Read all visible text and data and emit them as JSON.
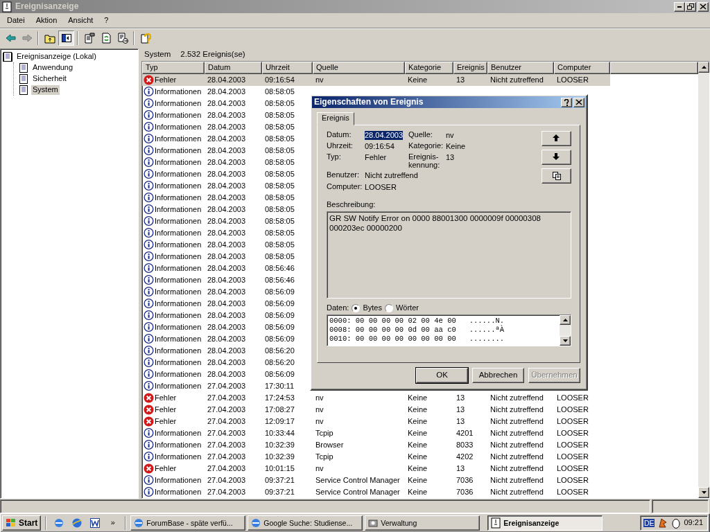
{
  "window": {
    "title": "Ereignisanzeige"
  },
  "menu": [
    "Datei",
    "Aktion",
    "Ansicht",
    "?"
  ],
  "toolbar": [
    {
      "kind": "back",
      "disabled": false,
      "pressed": false
    },
    {
      "kind": "forward",
      "disabled": true,
      "pressed": false
    },
    {
      "kind": "up",
      "disabled": false,
      "pressed": false
    },
    {
      "kind": "tree",
      "disabled": false,
      "pressed": true
    },
    {
      "kind": "properties",
      "disabled": false,
      "pressed": false
    },
    {
      "kind": "refresh",
      "disabled": false,
      "pressed": false
    },
    {
      "kind": "export",
      "disabled": false,
      "pressed": false
    },
    {
      "kind": "help",
      "disabled": false,
      "pressed": false
    }
  ],
  "tree": {
    "label": "Ereignisanzeige (Lokal)",
    "selected": false,
    "children": [
      {
        "label": "Anwendung",
        "selected": false
      },
      {
        "label": "Sicherheit",
        "selected": false
      },
      {
        "label": "System",
        "selected": true
      }
    ]
  },
  "list_header": {
    "title": "System",
    "count": "2.532 Ereignis(se)"
  },
  "table": {
    "columns": [
      "Typ",
      "Datum",
      "Uhrzeit",
      "Quelle",
      "Kategorie",
      "Ereignis",
      "Benutzer",
      "Computer"
    ],
    "rows": [
      {
        "kind": "error",
        "selected": true,
        "cells": [
          "Fehler",
          "28.04.2003",
          "09:16:54",
          "nv",
          "Keine",
          "13",
          "Nicht zutreffend",
          "LOOSER"
        ]
      },
      {
        "kind": "info",
        "selected": false,
        "cells": [
          "Informationen",
          "28.04.2003",
          "08:58:05"
        ]
      },
      {
        "kind": "info",
        "selected": false,
        "cells": [
          "Informationen",
          "28.04.2003",
          "08:58:05"
        ]
      },
      {
        "kind": "info",
        "selected": false,
        "cells": [
          "Informationen",
          "28.04.2003",
          "08:58:05"
        ]
      },
      {
        "kind": "info",
        "selected": false,
        "cells": [
          "Informationen",
          "28.04.2003",
          "08:58:05"
        ]
      },
      {
        "kind": "info",
        "selected": false,
        "cells": [
          "Informationen",
          "28.04.2003",
          "08:58:05"
        ]
      },
      {
        "kind": "info",
        "selected": false,
        "cells": [
          "Informationen",
          "28.04.2003",
          "08:58:05"
        ]
      },
      {
        "kind": "info",
        "selected": false,
        "cells": [
          "Informationen",
          "28.04.2003",
          "08:58:05"
        ]
      },
      {
        "kind": "info",
        "selected": false,
        "cells": [
          "Informationen",
          "28.04.2003",
          "08:58:05"
        ]
      },
      {
        "kind": "info",
        "selected": false,
        "cells": [
          "Informationen",
          "28.04.2003",
          "08:58:05"
        ]
      },
      {
        "kind": "info",
        "selected": false,
        "cells": [
          "Informationen",
          "28.04.2003",
          "08:58:05"
        ]
      },
      {
        "kind": "info",
        "selected": false,
        "cells": [
          "Informationen",
          "28.04.2003",
          "08:58:05"
        ]
      },
      {
        "kind": "info",
        "selected": false,
        "cells": [
          "Informationen",
          "28.04.2003",
          "08:58:05"
        ]
      },
      {
        "kind": "info",
        "selected": false,
        "cells": [
          "Informationen",
          "28.04.2003",
          "08:58:05"
        ]
      },
      {
        "kind": "info",
        "selected": false,
        "cells": [
          "Informationen",
          "28.04.2003",
          "08:58:05"
        ]
      },
      {
        "kind": "info",
        "selected": false,
        "cells": [
          "Informationen",
          "28.04.2003",
          "08:58:05"
        ]
      },
      {
        "kind": "info",
        "selected": false,
        "cells": [
          "Informationen",
          "28.04.2003",
          "08:56:46"
        ]
      },
      {
        "kind": "info",
        "selected": false,
        "cells": [
          "Informationen",
          "28.04.2003",
          "08:56:46"
        ]
      },
      {
        "kind": "info",
        "selected": false,
        "cells": [
          "Informationen",
          "28.04.2003",
          "08:56:09"
        ]
      },
      {
        "kind": "info",
        "selected": false,
        "cells": [
          "Informationen",
          "28.04.2003",
          "08:56:09"
        ]
      },
      {
        "kind": "info",
        "selected": false,
        "cells": [
          "Informationen",
          "28.04.2003",
          "08:56:09"
        ]
      },
      {
        "kind": "info",
        "selected": false,
        "cells": [
          "Informationen",
          "28.04.2003",
          "08:56:09"
        ]
      },
      {
        "kind": "info",
        "selected": false,
        "cells": [
          "Informationen",
          "28.04.2003",
          "08:56:09"
        ]
      },
      {
        "kind": "info",
        "selected": false,
        "cells": [
          "Informationen",
          "28.04.2003",
          "08:56:20"
        ]
      },
      {
        "kind": "info",
        "selected": false,
        "cells": [
          "Informationen",
          "28.04.2003",
          "08:56:20"
        ]
      },
      {
        "kind": "info",
        "selected": false,
        "cells": [
          "Informationen",
          "28.04.2003",
          "08:56:09"
        ]
      },
      {
        "kind": "info",
        "selected": false,
        "cells": [
          "Informationen",
          "27.04.2003",
          "17:30:11"
        ]
      },
      {
        "kind": "error",
        "selected": false,
        "cells": [
          "Fehler",
          "27.04.2003",
          "17:24:53",
          "nv",
          "Keine",
          "13",
          "Nicht zutreffend",
          "LOOSER"
        ]
      },
      {
        "kind": "error",
        "selected": false,
        "cells": [
          "Fehler",
          "27.04.2003",
          "17:08:27",
          "nv",
          "Keine",
          "13",
          "Nicht zutreffend",
          "LOOSER"
        ]
      },
      {
        "kind": "error",
        "selected": false,
        "cells": [
          "Fehler",
          "27.04.2003",
          "12:09:17",
          "nv",
          "Keine",
          "13",
          "Nicht zutreffend",
          "LOOSER"
        ]
      },
      {
        "kind": "info",
        "selected": false,
        "cells": [
          "Informationen",
          "27.04.2003",
          "10:33:44",
          "Tcpip",
          "Keine",
          "4201",
          "Nicht zutreffend",
          "LOOSER"
        ]
      },
      {
        "kind": "info",
        "selected": false,
        "cells": [
          "Informationen",
          "27.04.2003",
          "10:32:39",
          "Browser",
          "Keine",
          "8033",
          "Nicht zutreffend",
          "LOOSER"
        ]
      },
      {
        "kind": "info",
        "selected": false,
        "cells": [
          "Informationen",
          "27.04.2003",
          "10:32:39",
          "Tcpip",
          "Keine",
          "4202",
          "Nicht zutreffend",
          "LOOSER"
        ]
      },
      {
        "kind": "error",
        "selected": false,
        "cells": [
          "Fehler",
          "27.04.2003",
          "10:01:15",
          "nv",
          "Keine",
          "13",
          "Nicht zutreffend",
          "LOOSER"
        ]
      },
      {
        "kind": "info",
        "selected": false,
        "cells": [
          "Informationen",
          "27.04.2003",
          "09:37:21",
          "Service Control Manager",
          "Keine",
          "7036",
          "Nicht zutreffend",
          "LOOSER"
        ]
      },
      {
        "kind": "info",
        "selected": false,
        "cells": [
          "Informationen",
          "27.04.2003",
          "09:37:21",
          "Service Control Manager",
          "Keine",
          "7036",
          "Nicht zutreffend",
          "LOOSER"
        ]
      }
    ]
  },
  "dialog": {
    "title": "Eigenschaften von Ereignis",
    "tabs": [
      {
        "label": "Ereignis",
        "selected": true
      }
    ],
    "fields_left": [
      {
        "label": "Datum:",
        "value": "28.04.2003",
        "highlighted": true
      },
      {
        "label": "Uhrzeit:",
        "value": "09:16:54",
        "highlighted": false
      },
      {
        "label": "Typ:",
        "value": "Fehler",
        "highlighted": false
      },
      {
        "label": "Benutzer:",
        "value": "Nicht zutreffend",
        "highlighted": false
      },
      {
        "label": "Computer:",
        "value": "LOOSER",
        "highlighted": false
      }
    ],
    "fields_right": [
      {
        "label": "Quelle:",
        "value": "nv"
      },
      {
        "label": "Kategorie:",
        "value": "Keine"
      },
      {
        "label": "Ereignis-\nkennung:",
        "value": "13"
      }
    ],
    "nav_buttons": [
      {
        "kind": "previous"
      },
      {
        "kind": "next"
      },
      {
        "kind": "copy"
      }
    ],
    "description_label": "Beschreibung:",
    "description": "GR SW Notify Error on 0000 88001300 0000009f 00000308 000203ec 00000200",
    "data_label": "Daten:",
    "data_formats": [
      {
        "label": "Bytes",
        "selected": true
      },
      {
        "label": "Wörter",
        "selected": false
      }
    ],
    "hex_lines": [
      "0000: 00 00 00 00 02 00 4e 00   ......N.",
      "0008: 00 00 00 00 0d 00 aa c0   ......ªÀ",
      "0010: 00 00 00 00 00 00 00 00   ........"
    ],
    "buttons": [
      {
        "label": "OK",
        "default": true,
        "disabled": false
      },
      {
        "label": "Abbrechen",
        "default": false,
        "disabled": false
      },
      {
        "label": "Übernehmen",
        "default": false,
        "disabled": true
      }
    ]
  },
  "taskbar": {
    "start": "Start",
    "more": "»",
    "tasks": [
      {
        "kind": "browser",
        "label": "ForumBase - späte verfü...",
        "selected": false
      },
      {
        "kind": "browser",
        "label": "Google Suche: Studiense...",
        "selected": false
      },
      {
        "kind": "tools",
        "label": "Verwaltung",
        "selected": false
      },
      {
        "kind": "eventlog",
        "label": "Ereignisanzeige",
        "selected": true
      }
    ],
    "language": "DE",
    "clock": "09:21"
  }
}
